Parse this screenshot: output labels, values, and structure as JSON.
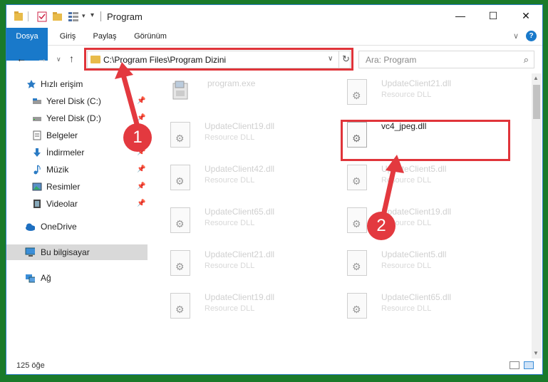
{
  "window": {
    "title": "Program",
    "minimize": "—",
    "maximize": "☐",
    "close": "✕"
  },
  "ribbon": {
    "tabs": [
      "Dosya",
      "Giriş",
      "Paylaş",
      "Görünüm"
    ],
    "collapse": "∨",
    "help": "?"
  },
  "navigation": {
    "back": "←",
    "forward": "→",
    "recent": "∨",
    "up": "↑",
    "address": "C:\\Program Files\\Program Dizini",
    "address_dropdown": "∨",
    "refresh": "↻",
    "search_placeholder": "Ara: Program",
    "search_icon": "⌕"
  },
  "sidebar": {
    "items": [
      {
        "label": "Hızlı erişim",
        "icon": "star-icon",
        "pinned": false
      },
      {
        "label": "Yerel Disk (C:)",
        "icon": "drive-icon",
        "pinned": true
      },
      {
        "label": "Yerel Disk (D:)",
        "icon": "drive-icon",
        "pinned": true
      },
      {
        "label": "Belgeler",
        "icon": "documents-icon",
        "pinned": true
      },
      {
        "label": "İndirmeler",
        "icon": "download-icon",
        "pinned": true
      },
      {
        "label": "Müzik",
        "icon": "music-icon",
        "pinned": true
      },
      {
        "label": "Resimler",
        "icon": "pictures-icon",
        "pinned": true
      },
      {
        "label": "Videolar",
        "icon": "video-icon",
        "pinned": true
      },
      {
        "label": "OneDrive",
        "icon": "onedrive-icon",
        "pinned": false
      },
      {
        "label": "Bu bilgisayar",
        "icon": "computer-icon",
        "pinned": false,
        "selected": true
      },
      {
        "label": "Ağ",
        "icon": "network-icon",
        "pinned": false
      }
    ],
    "pin_glyph": "📌"
  },
  "files": [
    {
      "name": "program.exe",
      "type": "",
      "kind": "exe"
    },
    {
      "name": "UpdateClient21.dll",
      "type": "Resource DLL",
      "kind": "dll"
    },
    {
      "name": "UpdateClient19.dll",
      "type": "Resource DLL",
      "kind": "dll"
    },
    {
      "name": "vc4_jpeg.dll",
      "type": "",
      "kind": "dll",
      "highlight": true
    },
    {
      "name": "UpdateClient42.dll",
      "type": "Resource DLL",
      "kind": "dll"
    },
    {
      "name": "UpdateClient5.dll",
      "type": "Resource DLL",
      "kind": "dll"
    },
    {
      "name": "UpdateClient65.dll",
      "type": "Resource DLL",
      "kind": "dll"
    },
    {
      "name": "UpdateClient19.dll",
      "type": "Resource DLL",
      "kind": "dll"
    },
    {
      "name": "UpdateClient21.dll",
      "type": "Resource DLL",
      "kind": "dll"
    },
    {
      "name": "UpdateClient5.dll",
      "type": "Resource DLL",
      "kind": "dll"
    },
    {
      "name": "UpdateClient19.dll",
      "type": "Resource DLL",
      "kind": "dll"
    },
    {
      "name": "UpdateClient65.dll",
      "type": "Resource DLL",
      "kind": "dll"
    }
  ],
  "status": {
    "count": "125 öğe"
  },
  "callouts": [
    "1",
    "2"
  ],
  "colors": {
    "accent": "#1979ca",
    "highlight_box": "#e0343a",
    "background": "#1a7a2a"
  }
}
